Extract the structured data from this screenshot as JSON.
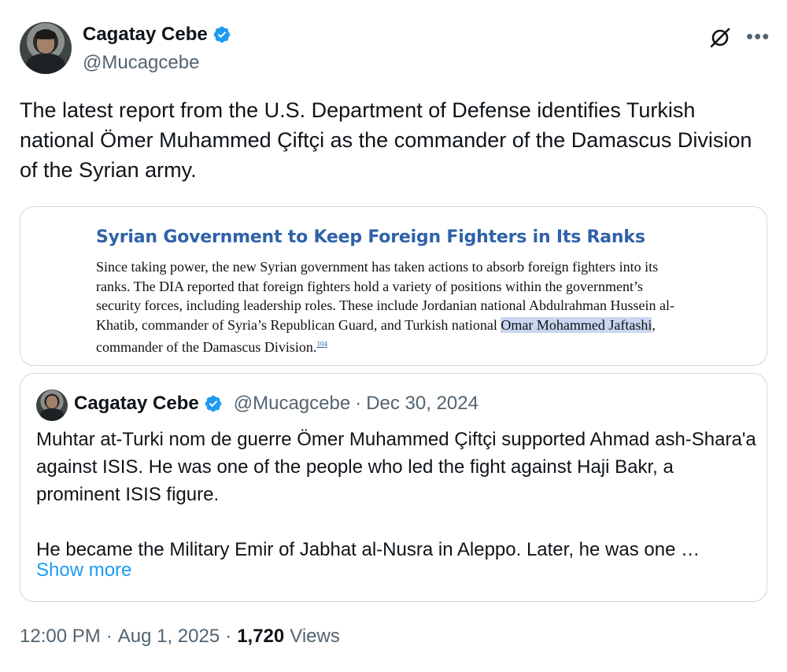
{
  "author": {
    "name": "Cagatay Cebe",
    "handle": "@Mucagcebe"
  },
  "icons": {
    "verified": "verified-badge-icon",
    "grok": "grok-icon",
    "more": "more-options-icon",
    "accent": "#1d9bf0"
  },
  "tweet": {
    "text": "The latest report from the U.S. Department of Defense identifies Turkish national Ömer Muhammed Çiftçi as the commander of the Damascus Division of the Syrian army."
  },
  "media": {
    "title": "Syrian Government to Keep Foreign Fighters in Its Ranks",
    "body_before": "Since taking power, the new Syrian government has taken actions to absorb foreign fighters into its ranks. The DIA reported that foreign fighters hold a variety of positions within the government’s security forces, including leadership roles. These include Jordanian national Abdulrahman Hussein al-Khatib, commander of Syria’s Republican Guard, and Turkish national ",
    "highlighted": "Omar Mohammed Jaftashi",
    "body_after": ", commander of the Damascus Division.",
    "footnote": "104"
  },
  "quote": {
    "name": "Cagatay Cebe",
    "handle": "@Mucagcebe",
    "separator": "·",
    "date": "Dec 30, 2024",
    "paragraph1": "Muhtar at-Turki nom de guerre Ömer Muhammed Çiftçi supported Ahmad ash-Shara'a against ISIS. He was one of the people who led the fight against Haji Bakr, a prominent ISIS figure.",
    "paragraph2": "He became the Military Emir of Jabhat al-Nusra in Aleppo. Later, he was one …",
    "show_more": "Show more"
  },
  "footer": {
    "time": "12:00 PM",
    "sep1": "·",
    "date": "Aug 1, 2025",
    "sep2": "·",
    "views_count": "1,720",
    "views_label": "Views"
  }
}
